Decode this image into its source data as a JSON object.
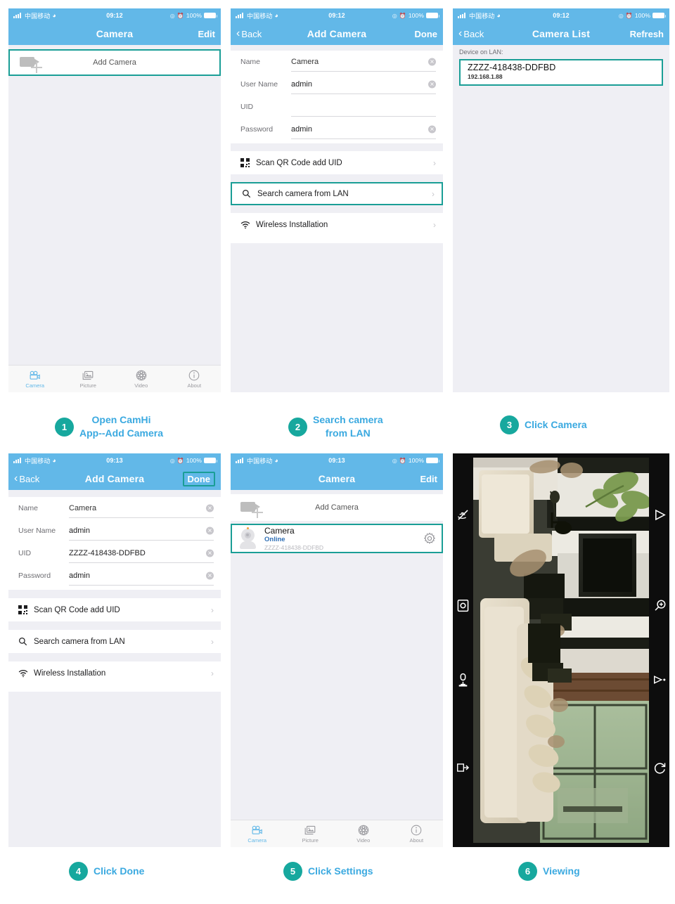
{
  "status_bar": {
    "carrier": "中国移动",
    "wifi_icon": "wifi-icon",
    "time_early": "09:12",
    "time_late": "09:13",
    "battery_pct": "100%",
    "location_icon": "location-arrow-icon",
    "alarm_icon": "alarm-clock-icon"
  },
  "panel1": {
    "nav": {
      "title": "Camera",
      "right": "Edit"
    },
    "add_camera_label": "Add Camera",
    "tabs": [
      {
        "label": "Camera",
        "icon": "video-camera-icon",
        "active": true
      },
      {
        "label": "Picture",
        "icon": "photos-icon",
        "active": false
      },
      {
        "label": "Video",
        "icon": "film-reel-icon",
        "active": false
      },
      {
        "label": "About",
        "icon": "info-circle-icon",
        "active": false
      }
    ]
  },
  "panel2": {
    "nav": {
      "back": "Back",
      "title": "Add Camera",
      "right": "Done"
    },
    "form": [
      {
        "label": "Name",
        "value": "Camera",
        "clearable": true
      },
      {
        "label": "User Name",
        "value": "admin",
        "clearable": true
      },
      {
        "label": "UID",
        "value": "",
        "clearable": false
      },
      {
        "label": "Password",
        "value": "admin",
        "clearable": true
      }
    ],
    "menu": [
      {
        "label": "Scan QR Code add UID",
        "icon": "qr-code-icon",
        "highlighted": false
      },
      {
        "label": "Search camera from LAN",
        "icon": "search-icon",
        "highlighted": true
      },
      {
        "label": "Wireless Installation",
        "icon": "wifi-icon",
        "highlighted": false
      }
    ]
  },
  "panel3": {
    "nav": {
      "back": "Back",
      "title": "Camera List",
      "right": "Refresh"
    },
    "section_header": "Device on LAN:",
    "device": {
      "uid": "ZZZZ-418438-DDFBD",
      "ip": "192.168.1.88"
    }
  },
  "panel4": {
    "nav": {
      "back": "Back",
      "title": "Add Camera",
      "right": "Done",
      "right_highlighted": true
    },
    "form": [
      {
        "label": "Name",
        "value": "Camera",
        "clearable": true
      },
      {
        "label": "User Name",
        "value": "admin",
        "clearable": true
      },
      {
        "label": "UID",
        "value": "ZZZZ-418438-DDFBD",
        "clearable": true
      },
      {
        "label": "Password",
        "value": "admin",
        "clearable": true
      }
    ],
    "menu": [
      {
        "label": "Scan QR Code add UID",
        "icon": "qr-code-icon",
        "highlighted": false
      },
      {
        "label": "Search camera from LAN",
        "icon": "search-icon",
        "highlighted": false
      },
      {
        "label": "Wireless Installation",
        "icon": "wifi-icon",
        "highlighted": false
      }
    ]
  },
  "panel5": {
    "nav": {
      "title": "Camera",
      "right": "Edit"
    },
    "add_camera_label": "Add Camera",
    "camera": {
      "name": "Camera",
      "status": "Online",
      "uid": "ZZZZ-418438-DDFBD",
      "settings_icon": "gear-icon"
    },
    "tabs": [
      {
        "label": "Camera",
        "icon": "video-camera-icon",
        "active": true
      },
      {
        "label": "Picture",
        "icon": "photos-icon",
        "active": false
      },
      {
        "label": "Video",
        "icon": "film-reel-icon",
        "active": false
      },
      {
        "label": "About",
        "icon": "info-circle-icon",
        "active": false
      }
    ]
  },
  "panel6": {
    "controls_left": [
      {
        "icon": "mute-audio-icon"
      },
      {
        "icon": "snapshot-icon"
      },
      {
        "icon": "microphone-icon"
      },
      {
        "icon": "fullscreen-exit-icon"
      }
    ],
    "controls_right": [
      {
        "icon": "play-icon"
      },
      {
        "icon": "zoom-in-icon"
      },
      {
        "icon": "record-icon"
      },
      {
        "icon": "rotate-icon"
      }
    ]
  },
  "steps": [
    {
      "number": "1",
      "line1": "Open CamHi",
      "line2": "App--Add Camera"
    },
    {
      "number": "2",
      "line1": "Search camera",
      "line2": "from LAN"
    },
    {
      "number": "3",
      "line1": "Click Camera",
      "line2": ""
    },
    {
      "number": "4",
      "line1": "Click Done",
      "line2": ""
    },
    {
      "number": "5",
      "line1": "Click Settings",
      "line2": ""
    },
    {
      "number": "6",
      "line1": "Viewing",
      "line2": ""
    }
  ],
  "colors": {
    "nav_blue": "#62b8e8",
    "accent_teal": "#1a9e96",
    "badge_teal": "#17a89e",
    "caption_blue": "#3aa9e0",
    "screen_bg": "#efeff4",
    "status_online": "#2f6fb5"
  }
}
